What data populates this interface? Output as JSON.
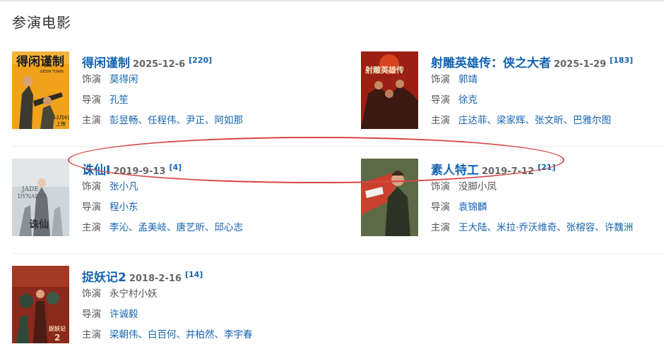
{
  "section_title": "参演电影",
  "labels": {
    "role": "饰演",
    "director": "导演",
    "cast": "主演"
  },
  "movies": [
    {
      "title": "得闲谨制",
      "date": "2025-12-6",
      "count": "[220]",
      "role": "莫得闲",
      "director": "孔笙",
      "cast": "彭昱畅、任程伟、尹正、阿如那",
      "poster_text": [
        "得闲谨制",
        "GESHI TOWN",
        "12月6日",
        "上映"
      ],
      "poster_colors": {
        "bg": "#f0a21c",
        "figure": "#3a3a2e"
      }
    },
    {
      "title": "射雕英雄传：侠之大者",
      "date": "2025-1-29",
      "count": "[183]",
      "role": "郭靖",
      "director": "徐克",
      "cast": "庄达菲、梁家辉、张文昕、巴雅尔图",
      "poster_text": [
        "射雕英雄传"
      ],
      "poster_colors": {
        "bg": "#9b1f12",
        "figure": "#3c1a12"
      }
    },
    {
      "title": "诛仙Ⅰ",
      "date": "2019-9-13",
      "count": "[4]",
      "role": "张小凡",
      "director": "程小东",
      "cast": "李沁、孟美岐、唐艺昕、邱心志",
      "poster_text": [
        "JADE",
        "DYNASTY",
        "诛仙"
      ],
      "poster_colors": {
        "bg": "#cfd5d8",
        "figure": "#6b6f74"
      }
    },
    {
      "title": "素人特工",
      "date": "2019-7-12",
      "count": "[21]",
      "role": "没脚小凤",
      "role_plain": true,
      "director": "袁锦麟",
      "cast": "王大陆、米拉·乔沃维奇、张榕容、许魏洲",
      "poster_text": [],
      "poster_colors": {
        "bg": "#5d6a48",
        "figure": "#2c3324"
      }
    },
    {
      "title": "捉妖记2",
      "date": "2018-2-16",
      "count": "[14]",
      "role": "永宁村小妖",
      "role_plain": true,
      "director": "许诚毅",
      "cast": "梁朝伟、白百何、井柏然、李宇春",
      "poster_text": [
        "捉妖记",
        "2"
      ],
      "poster_colors": {
        "bg": "#8a2a1c",
        "figure": "#2f4a38"
      }
    }
  ]
}
